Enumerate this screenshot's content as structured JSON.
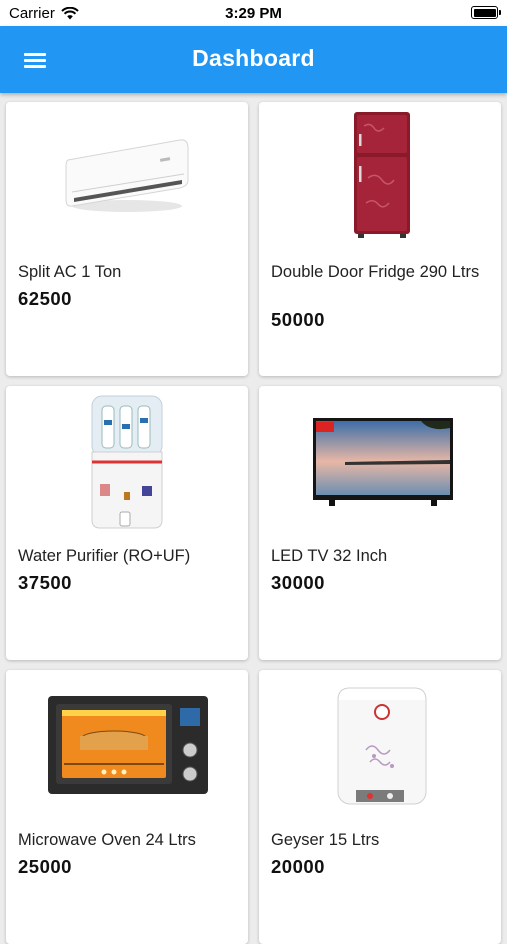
{
  "status_bar": {
    "carrier": "Carrier",
    "time": "3:29 PM"
  },
  "app_bar": {
    "title": "Dashboard"
  },
  "products": [
    {
      "name": "Split AC 1 Ton",
      "price": "62500",
      "icon": "split-ac"
    },
    {
      "name": "Double Door Fridge 290 Ltrs",
      "price": "50000",
      "icon": "fridge"
    },
    {
      "name": "Water Purifier (RO+UF)",
      "price": "37500",
      "icon": "water-purifier"
    },
    {
      "name": "LED TV 32 Inch",
      "price": "30000",
      "icon": "led-tv"
    },
    {
      "name": "Microwave Oven 24 Ltrs",
      "price": "25000",
      "icon": "microwave-oven"
    },
    {
      "name": "Geyser 15 Ltrs",
      "price": "20000",
      "icon": "geyser"
    }
  ],
  "colors": {
    "app_bar": "#2196f3",
    "background": "#ececec",
    "card": "#ffffff"
  }
}
